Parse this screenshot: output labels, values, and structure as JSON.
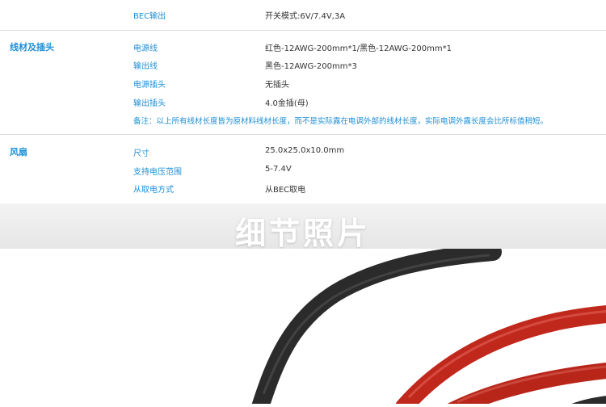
{
  "specs": {
    "row_bec": {
      "label": "BEC输出",
      "value": "开关模式:6V/7.4V,3A"
    },
    "wires": {
      "title": "线材及插头",
      "items": [
        {
          "label": "电源线",
          "value": "红色-12AWG-200mm*1/黑色-12AWG-200mm*1"
        },
        {
          "label": "输出线",
          "value": "黑色-12AWG-200mm*3"
        },
        {
          "label": "电源插头",
          "value": "无插头"
        },
        {
          "label": "输出插头",
          "value": "4.0金插(母)"
        }
      ],
      "note": "备注：以上所有线材长度皆为原材料线材长度，而不是实际露在电调外部的线材长度，实际电调外露长度会比所标值稍短。"
    },
    "fan": {
      "title": "风扇",
      "items": [
        {
          "label": "尺寸",
          "value": "25.0x25.0x10.0mm"
        },
        {
          "label": "支持电压范围",
          "value": "5-7.4V"
        },
        {
          "label": "从取电方式",
          "value": "从BEC取电"
        }
      ]
    }
  },
  "banner": {
    "title": "细节照片"
  },
  "colors": {
    "accent": "#1c8fd6",
    "text": "#333333",
    "wire_black": "#2b2b2b",
    "wire_red": "#c0281c"
  }
}
